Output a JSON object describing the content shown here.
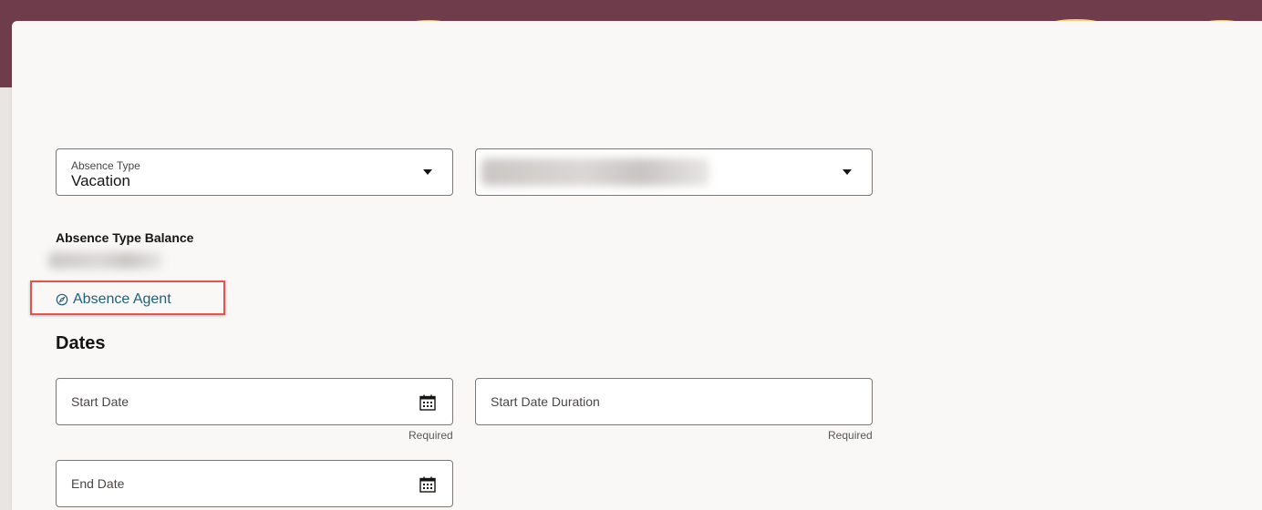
{
  "absence_type": {
    "label": "Absence Type",
    "value": "Vacation"
  },
  "balance": {
    "label": "Absence Type Balance"
  },
  "agent_link": {
    "label": "Absence Agent",
    "icon": "compass-icon"
  },
  "dates": {
    "heading": "Dates",
    "start_date": {
      "placeholder": "Start Date",
      "helper": "Required"
    },
    "start_date_duration": {
      "placeholder": "Start Date Duration",
      "helper": "Required"
    },
    "end_date": {
      "placeholder": "End Date"
    }
  },
  "colors": {
    "banner": "#6f3c4c",
    "link": "#22607a",
    "highlight": "#e4524d"
  }
}
